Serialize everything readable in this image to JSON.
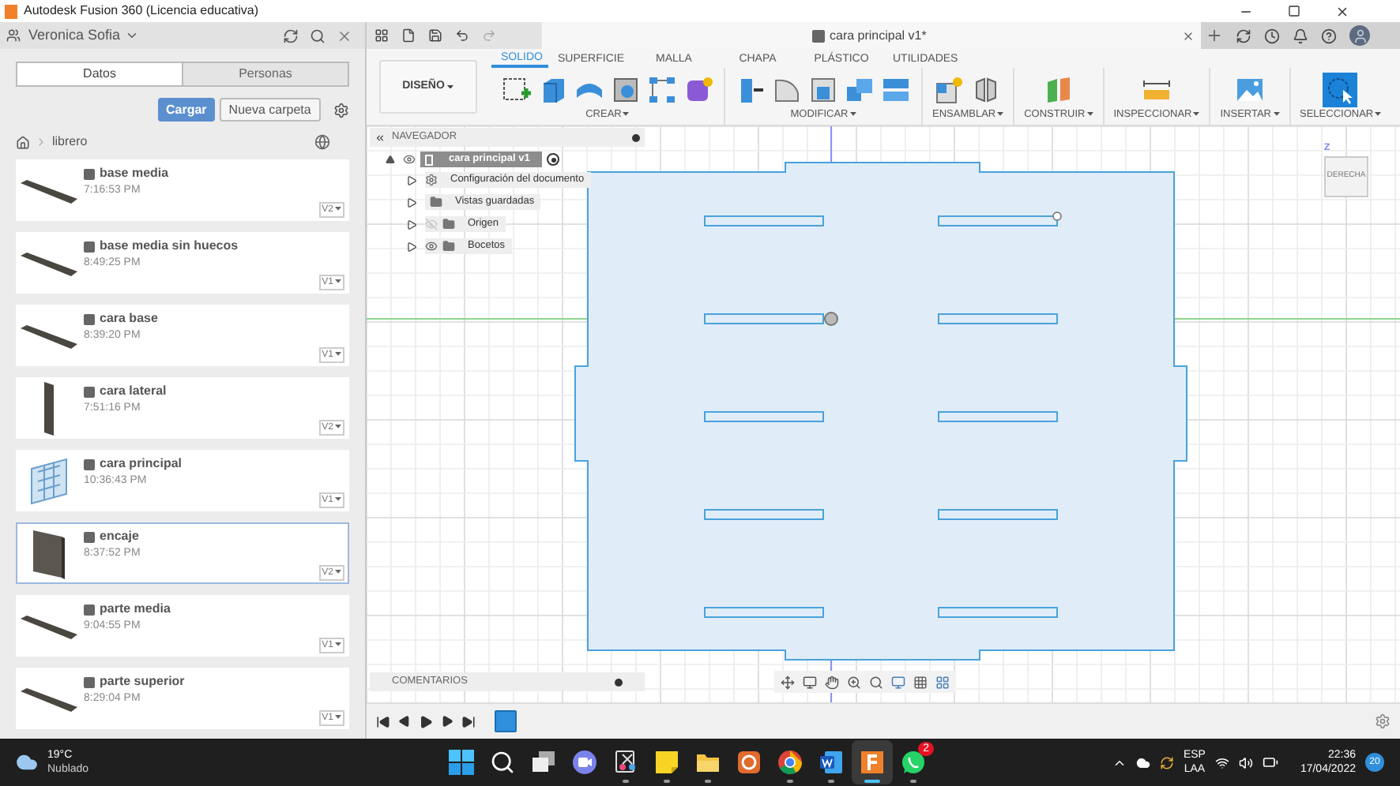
{
  "window": {
    "title": "Autodesk Fusion 360 (Licencia educativa)"
  },
  "data_panel": {
    "user": "Veronica Sofia",
    "tabs": [
      {
        "label": "Datos",
        "selected": true
      },
      {
        "label": "Personas",
        "selected": false
      }
    ],
    "upload_button": "Cargar",
    "new_folder_button": "Nueva carpeta",
    "breadcrumb": "librero",
    "files": [
      {
        "name": "base media",
        "time": "7:16:53 PM",
        "version": "V2",
        "kind": "plank",
        "selected": false
      },
      {
        "name": "base media sin huecos",
        "time": "8:49:25 PM",
        "version": "V1",
        "kind": "plank",
        "selected": false
      },
      {
        "name": "cara base",
        "time": "8:39:20 PM",
        "version": "V1",
        "kind": "plank",
        "selected": false
      },
      {
        "name": "cara lateral",
        "time": "7:51:16 PM",
        "version": "V2",
        "kind": "upright",
        "selected": false
      },
      {
        "name": "cara principal",
        "time": "10:36:43 PM",
        "version": "V1",
        "kind": "assembly",
        "selected": false
      },
      {
        "name": "encaje",
        "time": "8:37:52 PM",
        "version": "V2",
        "kind": "panel",
        "selected": true
      },
      {
        "name": "parte media",
        "time": "9:04:55 PM",
        "version": "V1",
        "kind": "plank",
        "selected": false
      },
      {
        "name": "parte superior",
        "time": "8:29:04 PM",
        "version": "V1",
        "kind": "plank",
        "selected": false
      }
    ]
  },
  "document_tab": {
    "title": "cara principal v1*"
  },
  "workspace": "DISEÑO",
  "toolbar_tabs": [
    {
      "label": "SOLIDO",
      "selected": true
    },
    {
      "label": "SUPERFICIE",
      "selected": false
    },
    {
      "label": "MALLA",
      "selected": false
    },
    {
      "label": "CHAPA",
      "selected": false
    },
    {
      "label": "PLÁSTICO",
      "selected": false
    },
    {
      "label": "UTILIDADES",
      "selected": false
    }
  ],
  "toolbar_groups": [
    {
      "label": "CREAR",
      "kind": "create"
    },
    {
      "label": "MODIFICAR",
      "kind": "modify"
    },
    {
      "label": "ENSAMBLAR",
      "kind": "assemble"
    },
    {
      "label": "CONSTRUIR",
      "kind": "construct"
    },
    {
      "label": "INSPECCIONAR",
      "kind": "inspect"
    },
    {
      "label": "INSERTAR",
      "kind": "insert"
    },
    {
      "label": "SELECCIONAR",
      "kind": "select"
    }
  ],
  "navigator": {
    "title": "NAVEGADOR",
    "root": {
      "label": "cara principal v1",
      "visible": true,
      "children": [
        {
          "label": "Configuración del documento",
          "kind": "settings"
        },
        {
          "label": "Vistas guardadas",
          "kind": "folder"
        },
        {
          "label": "Origen",
          "kind": "layer",
          "visible": false
        },
        {
          "label": "Bocetos",
          "kind": "layer",
          "visible": true
        }
      ]
    }
  },
  "comments": "COMENTARIOS",
  "view_cube": {
    "axis": "Z",
    "face": "DERECHA"
  },
  "taskbar": {
    "weather": {
      "temperature": "19°C",
      "condition": "Nublado"
    },
    "apps": [
      {
        "kind": "start",
        "running": false,
        "active": false
      },
      {
        "kind": "search",
        "running": false,
        "active": false
      },
      {
        "kind": "taskview",
        "running": false,
        "active": false
      },
      {
        "kind": "chat",
        "running": false,
        "active": false
      },
      {
        "kind": "snip",
        "running": true,
        "active": false
      },
      {
        "kind": "notes",
        "running": true,
        "active": false
      },
      {
        "kind": "explorer",
        "running": true,
        "active": false
      },
      {
        "kind": "office",
        "running": false,
        "active": false
      },
      {
        "kind": "chrome",
        "running": true,
        "active": false
      },
      {
        "kind": "word",
        "running": true,
        "active": false
      },
      {
        "kind": "fusion",
        "running": true,
        "active": true
      },
      {
        "kind": "whatsapp",
        "running": true,
        "active": false,
        "badge": "2"
      }
    ],
    "language": "ESP",
    "layout": "LAA",
    "time": "22:36",
    "date": "17/04/2022",
    "notifications": "20"
  }
}
